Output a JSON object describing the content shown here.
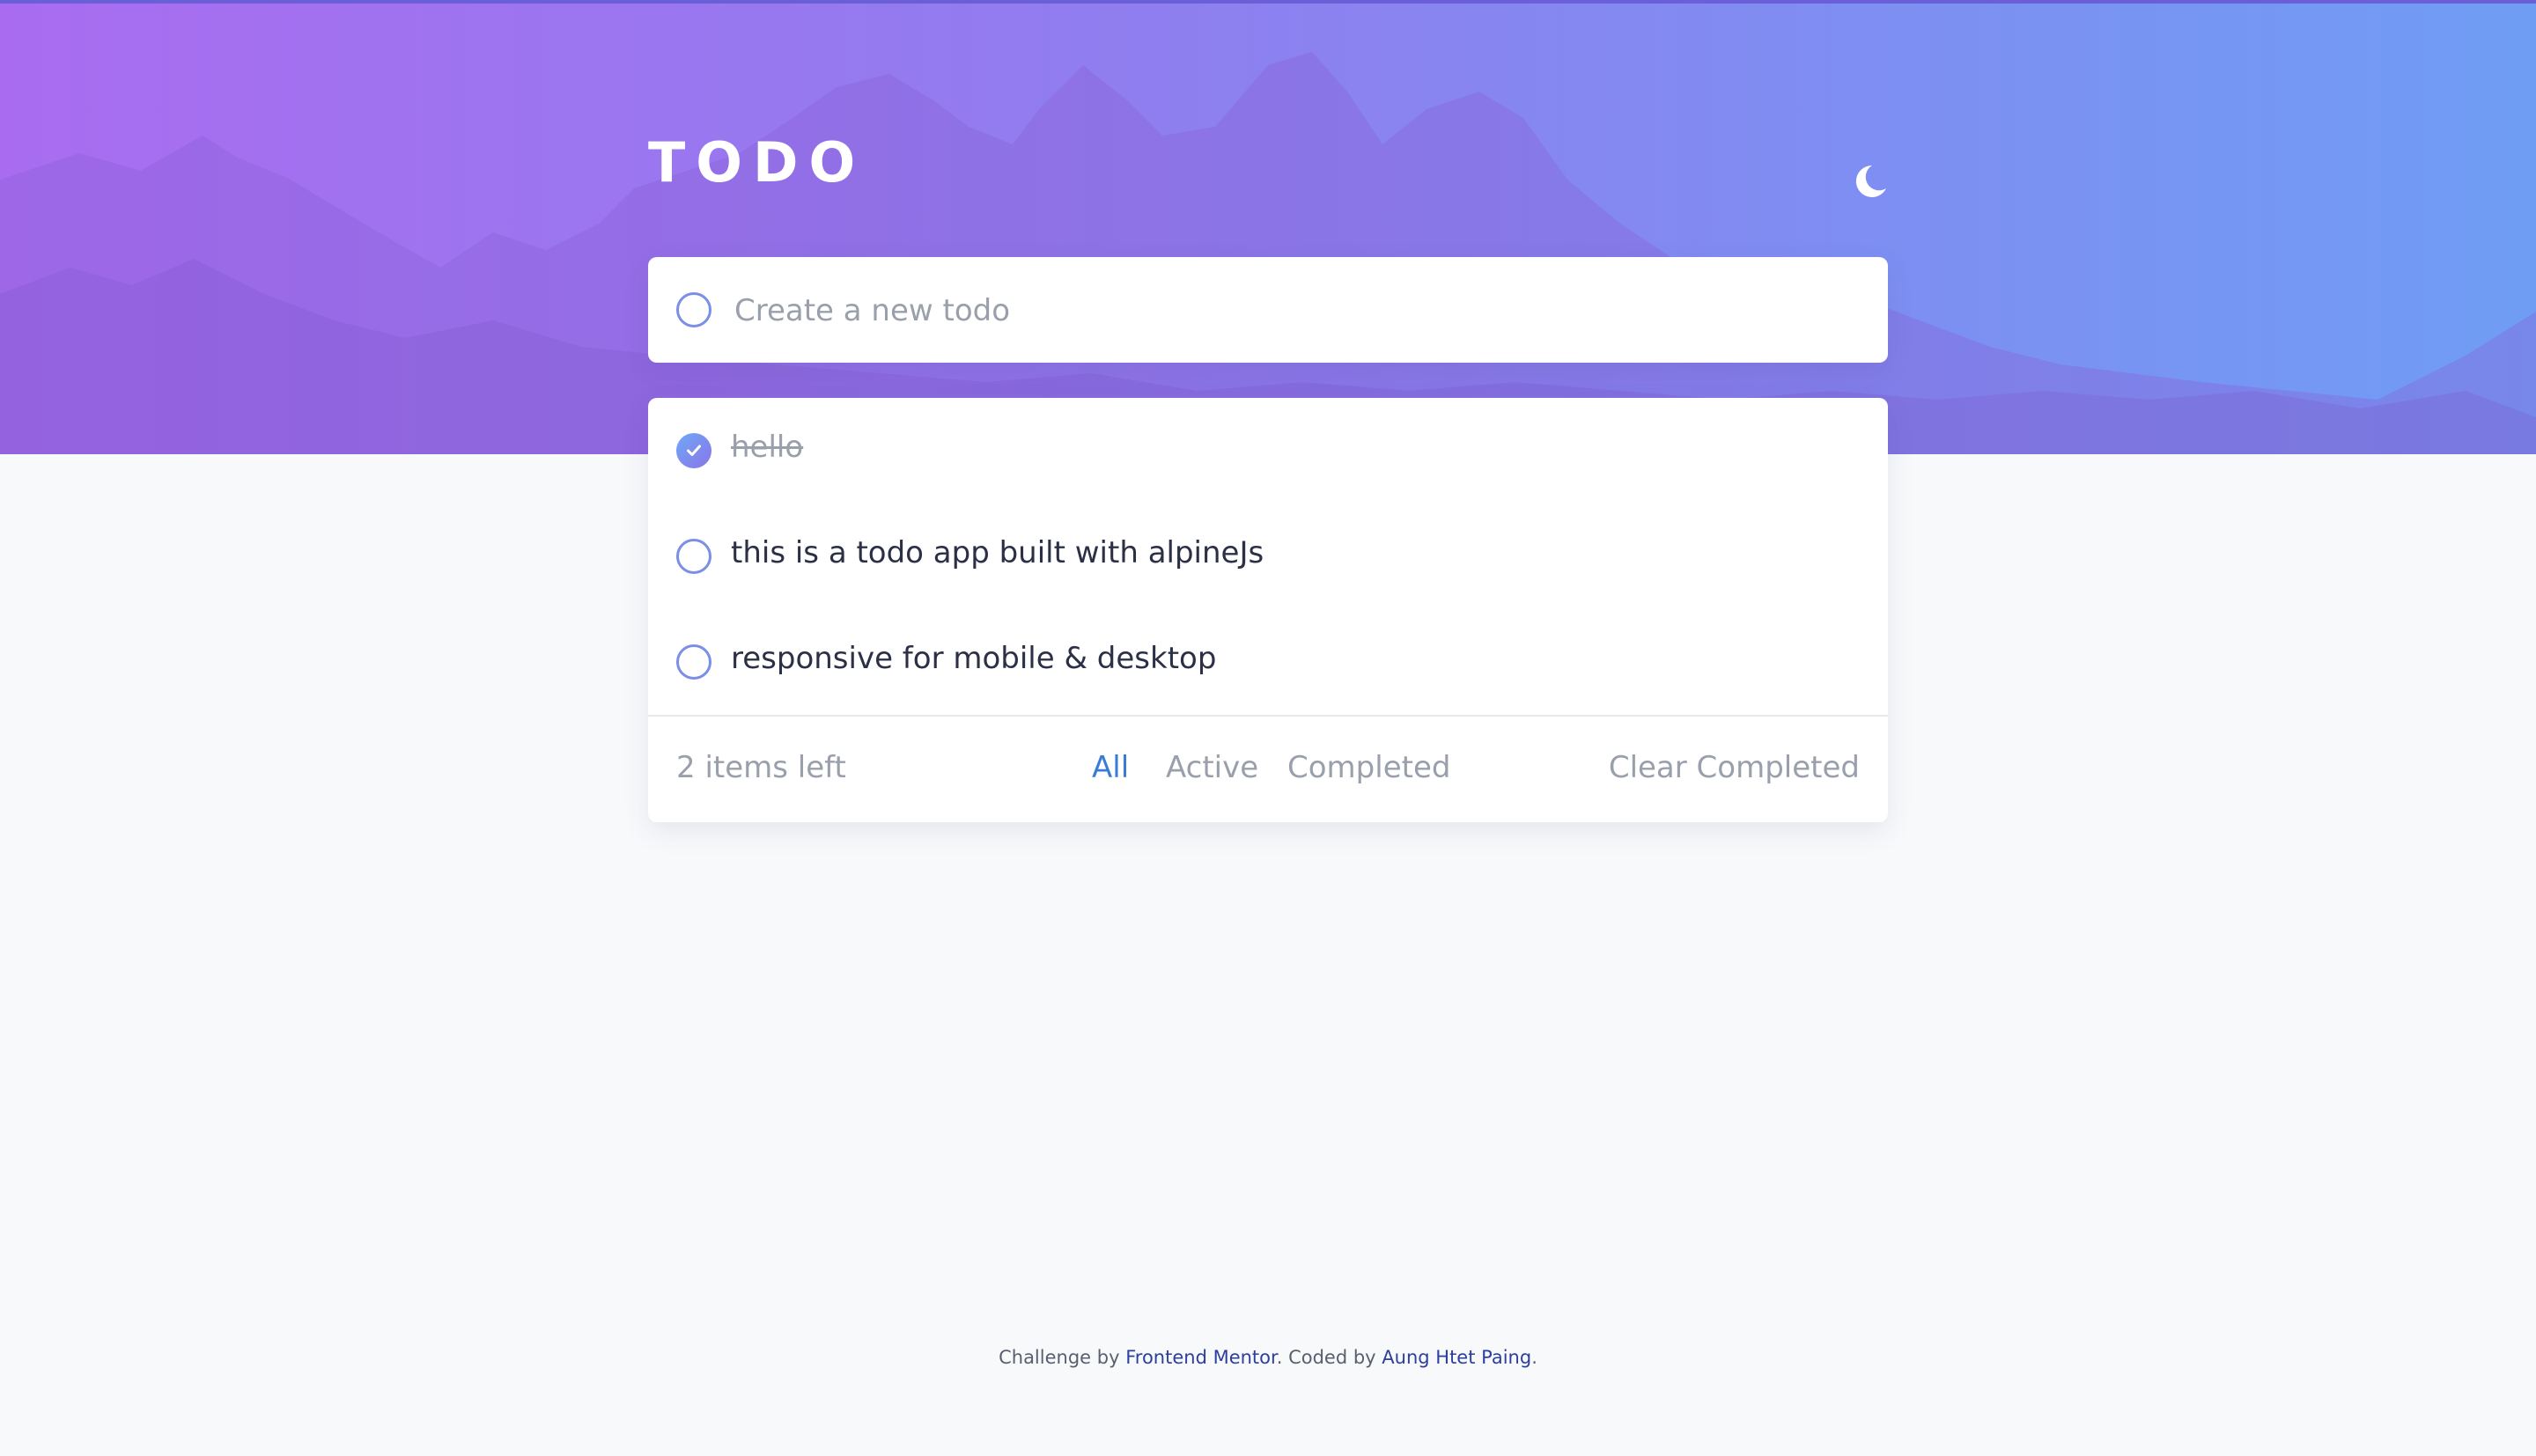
{
  "header": {
    "title": "TODO",
    "theme_toggle_icon": "moon-icon"
  },
  "new_todo": {
    "placeholder": "Create a new todo",
    "value": ""
  },
  "todos": [
    {
      "text": "hello",
      "completed": true
    },
    {
      "text": "this is a todo app built with alpineJs",
      "completed": false
    },
    {
      "text": "responsive for mobile & desktop",
      "completed": false
    }
  ],
  "footer": {
    "items_left": "2 items left",
    "filters": [
      "All",
      "Active",
      "Completed"
    ],
    "active_filter": "All",
    "clear_completed": "Clear Completed"
  },
  "attribution": {
    "prefix": "Challenge by",
    "mentor_link": "Frontend Mentor",
    "middle": ". Coded by",
    "author_link": "Aung Htet Paing",
    "suffix": "."
  },
  "colors": {
    "accent": "#3a7bd5",
    "gradient_start": "#a96cf0",
    "gradient_end": "#6f9df4",
    "background": "#f8f9fb"
  }
}
